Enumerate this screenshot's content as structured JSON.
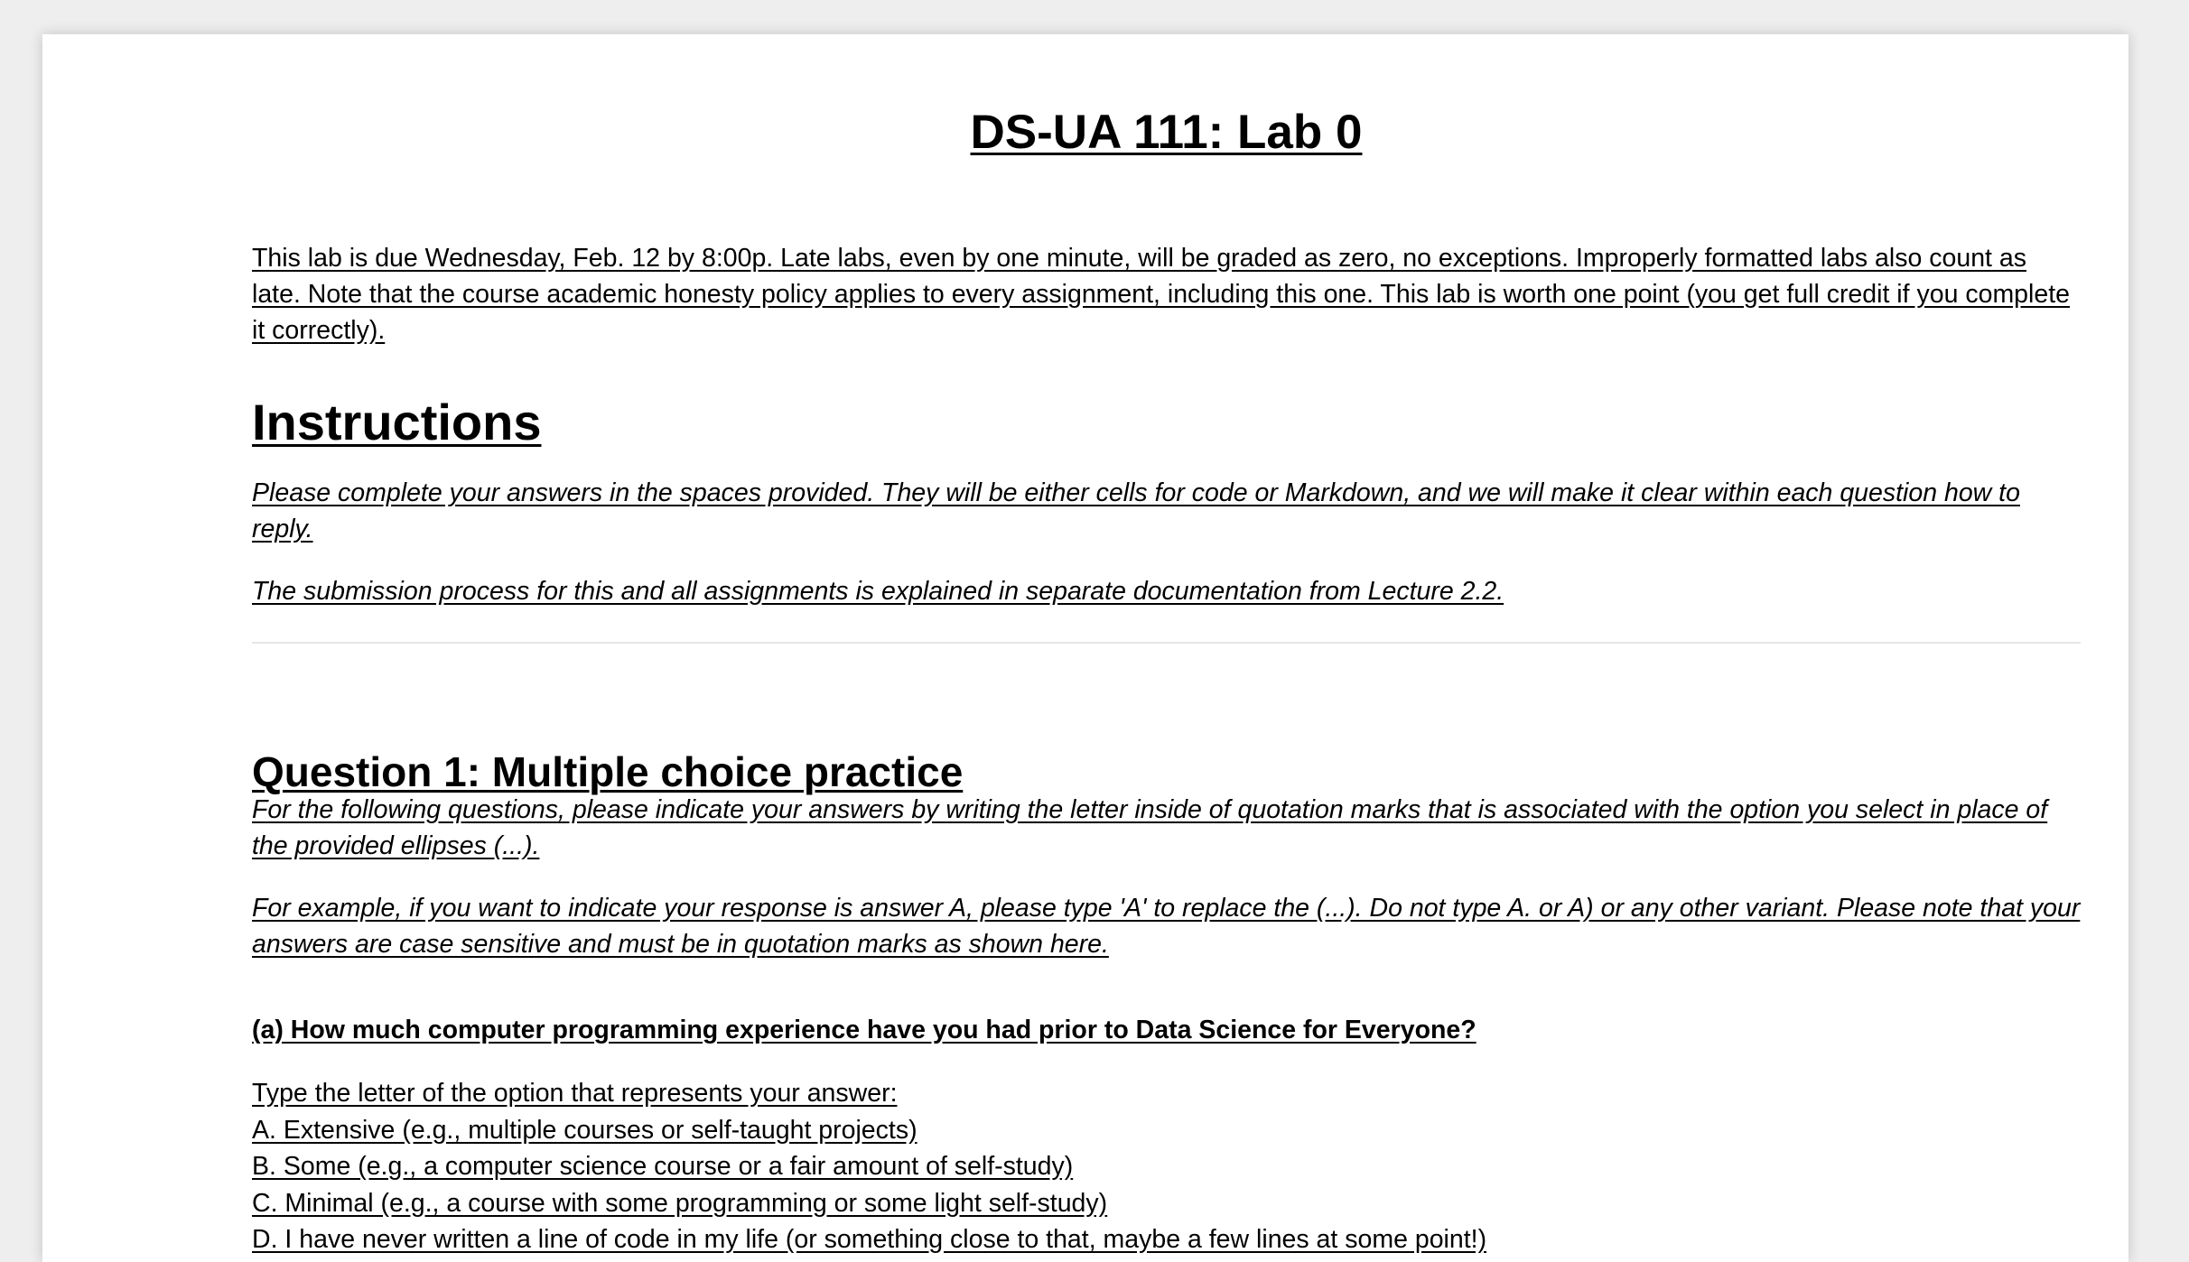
{
  "title": "DS-UA 111: Lab 0",
  "intro": "This lab is due Wednesday, Feb. 12 by 8:00p. Late labs, even by one minute, will be graded as zero, no exceptions. Improperly formatted labs also count as late. Note that the course academic honesty policy applies to every assignment, including this one. This lab is worth one point (you get full credit if you complete it correctly).",
  "instructions": {
    "heading": "Instructions",
    "para1": "Please complete your answers in the spaces provided. They will be either cells for code or Markdown, and we will make it clear within each question how to reply.",
    "para2": "The submission process for this and all assignments is explained in separate documentation from Lecture 2.2."
  },
  "question1": {
    "heading": "Question 1: Multiple choice practice",
    "para1": "For the following questions, please indicate your answers by writing the letter inside of quotation marks that is associated with the option you select in place of the provided ellipses (...).",
    "para2": "For example, if you want to indicate your response is answer A, please type 'A' to replace the (...). Do not type A. or A) or any other variant. Please note that your answers are case sensitive and must be in quotation marks as shown here.",
    "part_a": {
      "heading": "(a) How much computer programming experience have you had prior to Data Science for Everyone?",
      "prompt": "Type the letter of the option that represents your answer:",
      "options": [
        "A. Extensive (e.g., multiple courses or self-taught projects)",
        "B. Some (e.g., a computer science course or a fair amount of self-study)",
        "C. Minimal (e.g., a course with some programming or some light self-study)",
        "D. I have never written a line of code in my life (or something close to that, maybe a few lines at some point!)"
      ]
    }
  }
}
